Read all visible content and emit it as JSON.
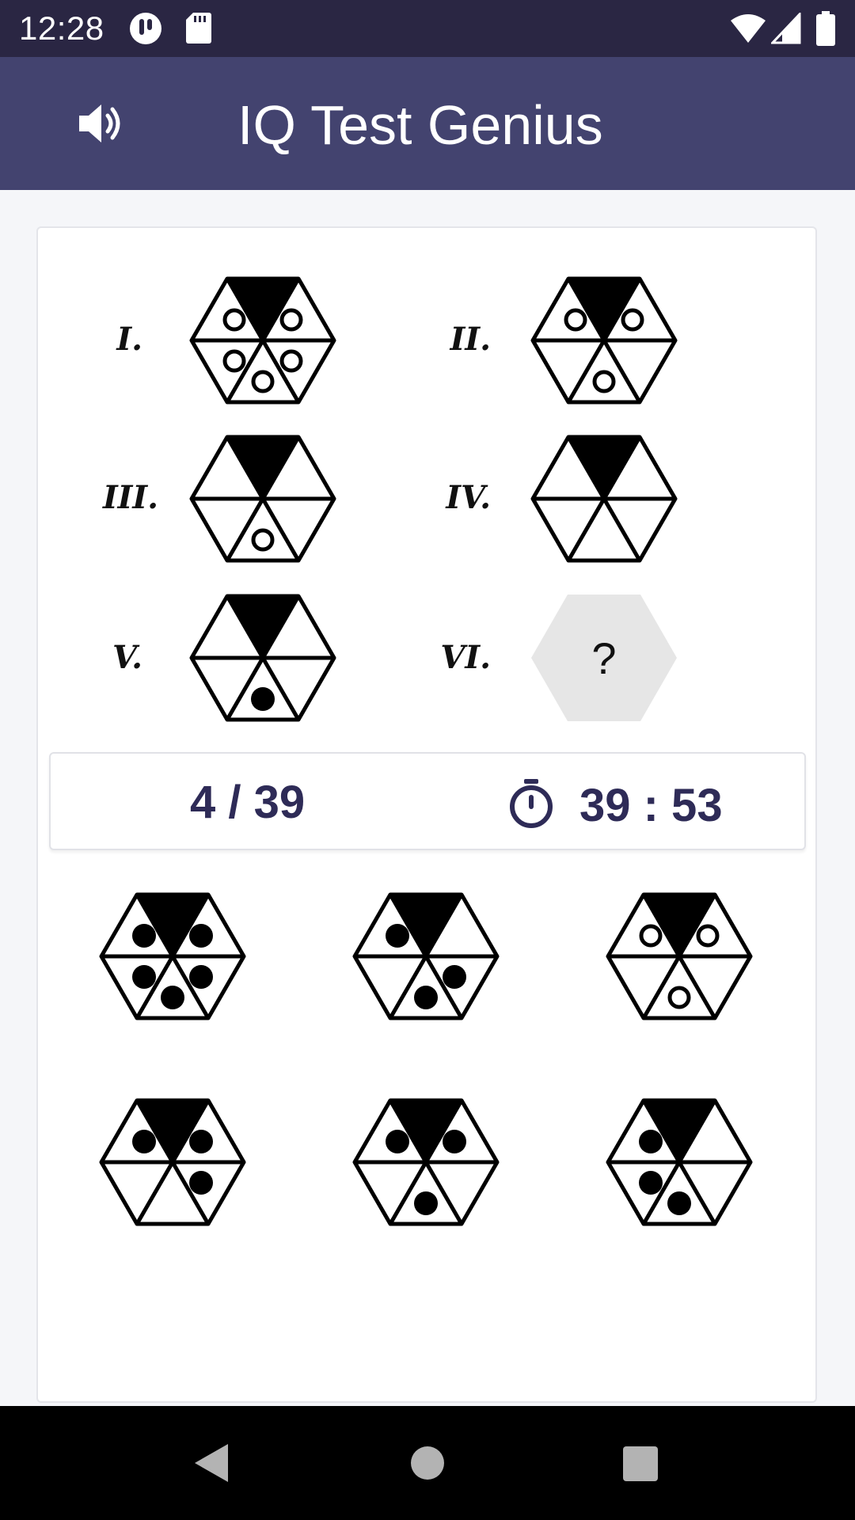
{
  "status_bar": {
    "time": "12:28",
    "icons": [
      "notification-app-icon",
      "sd-card-icon",
      "wifi-icon",
      "signal-icon",
      "battery-icon"
    ]
  },
  "app_bar": {
    "title": "IQ Test Genius",
    "sound_icon": "speaker-volume-icon",
    "background": "#43436f"
  },
  "puzzle": {
    "items": [
      {
        "label": "I.",
        "top_black": true,
        "dots": [
          "outline",
          "outline",
          "outline",
          "outline",
          "outline"
        ]
      },
      {
        "label": "II.",
        "top_black": true,
        "dots": [
          "outline",
          "outline",
          "none",
          "outline",
          "none"
        ]
      },
      {
        "label": "III.",
        "top_black": true,
        "dots": [
          "none",
          "none",
          "none",
          "outline",
          "none"
        ]
      },
      {
        "label": "IV.",
        "top_black": true,
        "dots": [
          "none",
          "none",
          "none",
          "none",
          "none"
        ]
      },
      {
        "label": "V.",
        "top_black": true,
        "dots": [
          "none",
          "none",
          "none",
          "filled",
          "none"
        ]
      },
      {
        "label": "VI.",
        "unknown": true,
        "placeholder": "?"
      }
    ]
  },
  "info": {
    "progress": "4 / 39",
    "timer_icon": "stopwatch-icon",
    "timer": "39 : 53"
  },
  "options": [
    {
      "dots": [
        "filled",
        "filled",
        "filled",
        "filled",
        "filled"
      ]
    },
    {
      "dots": [
        "filled",
        "none",
        "none",
        "filled",
        "filled"
      ]
    },
    {
      "dots": [
        "outline",
        "outline",
        "none",
        "outline",
        "none"
      ]
    },
    {
      "dots": [
        "filled",
        "filled",
        "none",
        "none",
        "filled"
      ]
    },
    {
      "dots": [
        "filled",
        "filled",
        "none",
        "filled",
        "none"
      ]
    },
    {
      "dots": [
        "filled",
        "none",
        "filled",
        "filled",
        "none"
      ]
    }
  ],
  "nav_bar": {
    "icons": [
      "back-icon",
      "home-icon",
      "recents-icon"
    ]
  },
  "colors": {
    "status_bar": "#2a2643",
    "accent_text": "#2e2b57"
  }
}
